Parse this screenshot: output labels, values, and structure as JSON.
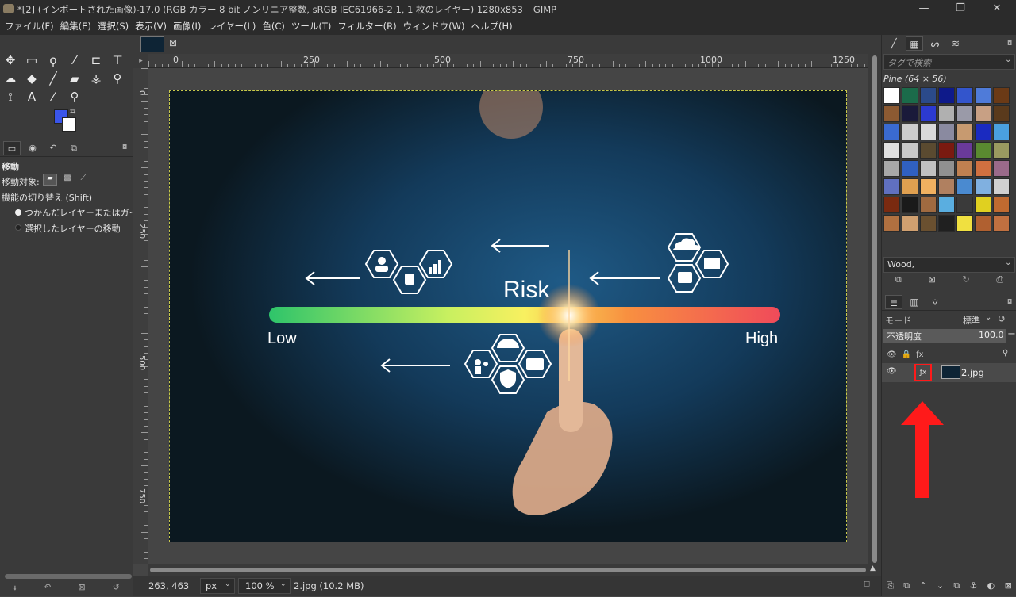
{
  "window": {
    "title": "*[2] (インポートされた画像)-17.0 (RGB カラー 8 bit ノンリニア整数, sRGB IEC61966-2.1, 1 枚のレイヤー) 1280x853 – GIMP",
    "minimize": "—",
    "maximize": "❐",
    "close": "✕"
  },
  "menu": [
    "ファイル(F)",
    "編集(E)",
    "選択(S)",
    "表示(V)",
    "画像(I)",
    "レイヤー(L)",
    "色(C)",
    "ツール(T)",
    "フィルター(R)",
    "ウィンドウ(W)",
    "ヘルプ(H)"
  ],
  "toolbox": {
    "tool_icons": [
      "move-icon",
      "rect-select-icon",
      "lasso-icon",
      "fuzzy-select-icon",
      "crop-icon",
      "transform-icon",
      "warp-icon",
      "bucket-fill-icon",
      "paintbrush-icon",
      "eraser-icon",
      "clone-icon",
      "smudge-icon",
      "paths-icon",
      "text-icon",
      "color-picker-icon",
      "zoom-icon"
    ],
    "tool_glyphs": [
      "✥",
      "▭",
      "ϙ",
      "⁄",
      "⊏",
      "⊤",
      "☁",
      "◆",
      "╱",
      "▰",
      "⚶",
      "⚲",
      "⟟",
      "A",
      "⁄",
      "⚲"
    ],
    "fg_color": "#3a55ea",
    "bg_color": "#ffffff"
  },
  "tool_options": {
    "title": "移動",
    "target_label": "移動対象:",
    "toggle_label": "機能の切り替え  (Shift)",
    "option_1": "つかんだレイヤーまたはガイドの",
    "option_2": "選択したレイヤーの移動"
  },
  "rulers": {
    "h_labels": [
      "0",
      "250",
      "500",
      "750",
      "1000",
      "1250"
    ],
    "v_labels": [
      "0",
      "250",
      "500",
      "750"
    ]
  },
  "image": {
    "risk_label": "Risk",
    "low_label": "Low",
    "high_label": "High"
  },
  "statusbar": {
    "coords": "263, 463",
    "unit": "px",
    "zoom": "100 %",
    "info": "2.jpg (10.2 MB)"
  },
  "brushes_panel": {
    "tag_placeholder": "タグで検索",
    "pattern_name": "Pine (64 × 56)",
    "selected_pattern": "Wood,",
    "pattern_colors": [
      "#ffffff",
      "#1b6b4a",
      "#2b4a8a",
      "#0e1a8a",
      "#3355cc",
      "#4f7bd9",
      "#6b3a16",
      "#8c5a32",
      "#1a1a3a",
      "#2c3ad0",
      "#b0b0b0",
      "#9a9aa8",
      "#c8a084",
      "#5a3a1c",
      "#3a6ad0",
      "#cccccc",
      "#d9d9d9",
      "#8a8aa0",
      "#c79a70",
      "#1a2ac0",
      "#4aa0e0",
      "#e0e0e0",
      "#c9c9c9",
      "#5a4a30",
      "#7a1a10",
      "#6a3a9a",
      "#5a8a30",
      "#9a9a60",
      "#a8a8a8",
      "#3060c0",
      "#c0c0c0",
      "#909090",
      "#c08050",
      "#d07040",
      "#9a6a8a",
      "#6070c0",
      "#e0a050",
      "#f0b060",
      "#b08060",
      "#4a8ad0",
      "#80b0e0",
      "#d0d0d0",
      "#7a2a10",
      "#1a1a1a",
      "#a06a40",
      "#5aaee0",
      "#3a3a3a",
      "#e0d020",
      "#c06a30",
      "#b07040",
      "#d0a070",
      "#6a5030",
      "#202020",
      "#f0e040",
      "#b06030",
      "#c07040"
    ]
  },
  "layers_panel": {
    "mode_label": "モード",
    "mode_value": "標準",
    "opacity_label": "不透明度",
    "opacity_value": "100.0",
    "layer_name": "2.jpg"
  }
}
